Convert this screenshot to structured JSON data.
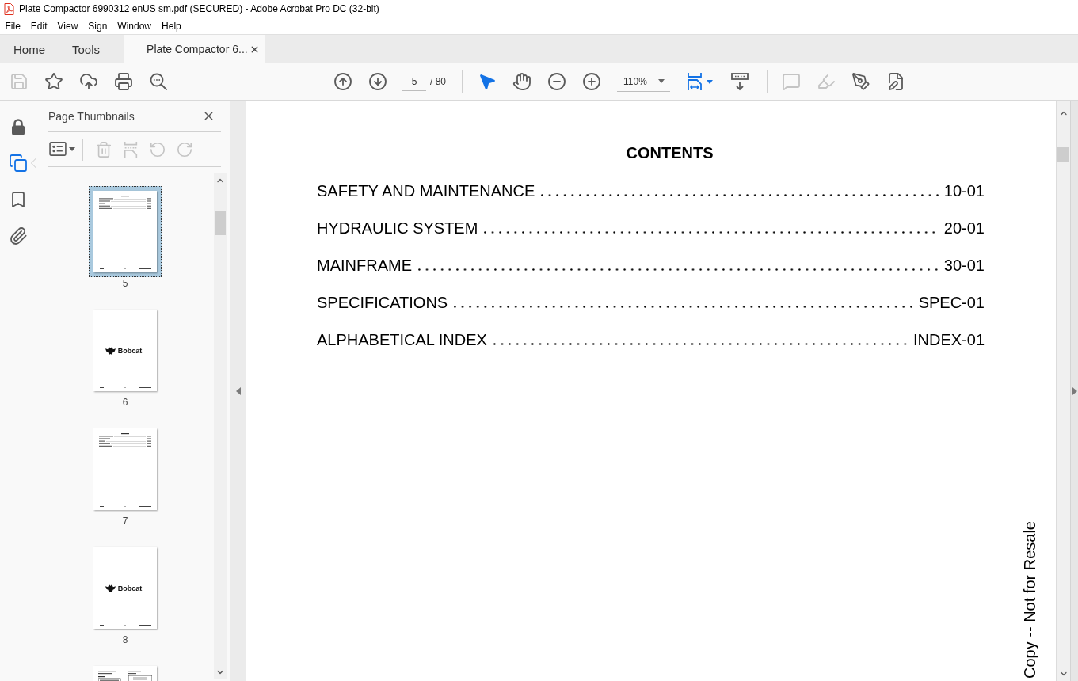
{
  "window": {
    "title": "Plate Compactor 6990312 enUS sm.pdf (SECURED) - Adobe Acrobat Pro DC (32-bit)"
  },
  "menu_bar": [
    "File",
    "Edit",
    "View",
    "Sign",
    "Window",
    "Help"
  ],
  "tabs": [
    {
      "label": "Home",
      "selected": false,
      "closable": false
    },
    {
      "label": "Tools",
      "selected": false,
      "closable": false
    },
    {
      "label": "Plate Compactor 6...",
      "selected": true,
      "closable": true
    }
  ],
  "toolbar": {
    "file_tools": [
      {
        "kind": "save",
        "disabled": true
      },
      {
        "kind": "star",
        "disabled": false
      },
      {
        "kind": "upload",
        "disabled": false
      },
      {
        "kind": "print",
        "disabled": false
      },
      {
        "kind": "find",
        "disabled": false
      }
    ],
    "page_number": "5",
    "page_count": "/ 80",
    "view_tools": [
      {
        "kind": "select",
        "selected": true
      },
      {
        "kind": "hand",
        "selected": false
      }
    ],
    "zoom": "110%",
    "display_tools": [
      {
        "kind": "fit",
        "selected": true
      },
      {
        "kind": "scroll",
        "selected": false
      }
    ],
    "markup_tools": [
      {
        "kind": "comment",
        "disabled": true
      },
      {
        "kind": "highlight",
        "disabled": true
      },
      {
        "kind": "sign",
        "disabled": false
      },
      {
        "kind": "edit",
        "disabled": false
      }
    ]
  },
  "navigation_rail": [
    {
      "kind": "lock",
      "selected": false
    },
    {
      "kind": "pages",
      "selected": true
    },
    {
      "kind": "bookmarks",
      "selected": false
    },
    {
      "kind": "attachments",
      "selected": false
    }
  ],
  "thumbnails_panel": {
    "title": "Page Thumbnails",
    "tools": [
      {
        "kind": "options",
        "disabled": false
      },
      {
        "kind": "delete",
        "disabled": true
      },
      {
        "kind": "extract",
        "disabled": true
      },
      {
        "kind": "rotate_left",
        "disabled": true
      },
      {
        "kind": "rotate_right",
        "disabled": true
      }
    ],
    "thumbnails": [
      {
        "kind": "contents",
        "page": "5",
        "selected": true
      },
      {
        "kind": "logo",
        "page": "6",
        "logo_text": "Bobcat",
        "selected": false
      },
      {
        "kind": "contents",
        "page": "7",
        "selected": false
      },
      {
        "kind": "logo",
        "page": "8",
        "logo_text": "Bobcat",
        "selected": false
      },
      {
        "kind": "diagram",
        "selected": false
      }
    ]
  },
  "document": {
    "heading": "CONTENTS",
    "entries": [
      {
        "title": "SAFETY AND MAINTENANCE",
        "page": "10-01"
      },
      {
        "title": "HYDRAULIC SYSTEM",
        "page": "20-01"
      },
      {
        "title": "MAINFRAME",
        "page": "30-01"
      },
      {
        "title": "SPECIFICATIONS",
        "page": "SPEC-01"
      },
      {
        "title": "ALPHABETICAL INDEX",
        "page": "INDEX-01"
      }
    ],
    "margin_note": "Copy -- Not for Resale"
  }
}
